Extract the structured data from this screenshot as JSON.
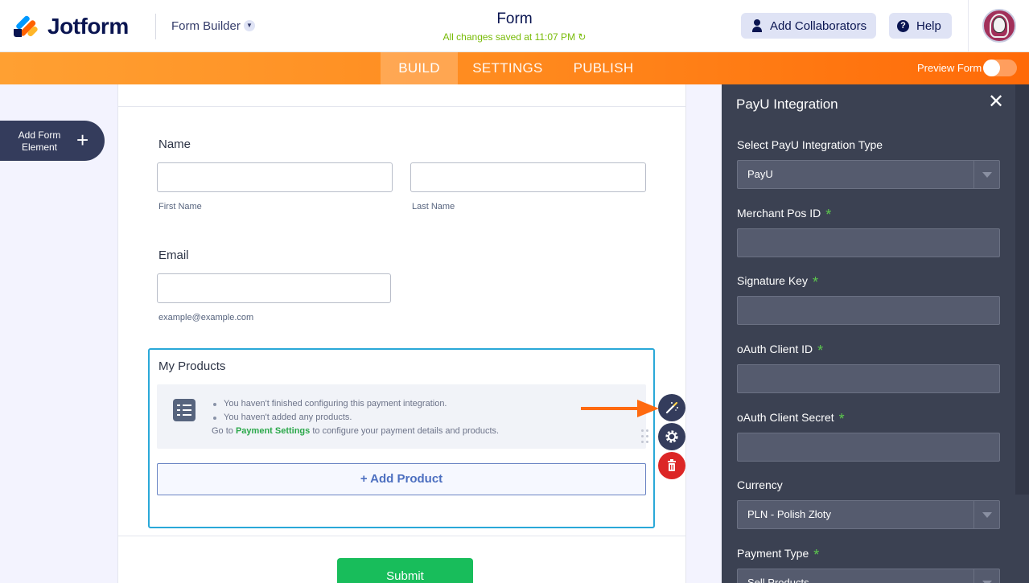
{
  "header": {
    "logo_text": "Jotform",
    "builder_label": "Form Builder",
    "form_title": "Form",
    "saved_status": "All changes saved at 11:07 PM",
    "add_collaborators_label": "Add Collaborators",
    "help_label": "Help"
  },
  "navbar": {
    "tabs": [
      {
        "label": "BUILD",
        "active": true
      },
      {
        "label": "SETTINGS",
        "active": false
      },
      {
        "label": "PUBLISH",
        "active": false
      }
    ],
    "preview_label": "Preview Form",
    "preview_enabled": false
  },
  "sidebar": {
    "add_element_label_line1": "Add Form",
    "add_element_label_line2": "Element"
  },
  "form": {
    "name_label": "Name",
    "first_name_sublabel": "First Name",
    "last_name_sublabel": "Last Name",
    "first_name_value": "",
    "last_name_value": "",
    "email_label": "Email",
    "email_value": "",
    "email_sublabel": "example@example.com",
    "products_title": "My Products",
    "notice_items": [
      "You haven't finished configuring this payment integration.",
      "You haven't added any products."
    ],
    "notice_go_prefix": "Go to ",
    "notice_go_link": "Payment Settings",
    "notice_go_suffix": " to configure your payment details and products.",
    "add_product_label": "+ Add Product",
    "submit_label": "Submit"
  },
  "panel": {
    "title": "PayU Integration",
    "integration_type_label": "Select PayU Integration Type",
    "integration_type_value": "PayU",
    "merchant_pos_label": "Merchant Pos ID",
    "signature_key_label": "Signature Key",
    "oauth_client_id_label": "oAuth Client ID",
    "oauth_client_secret_label": "oAuth Client Secret",
    "currency_label": "Currency",
    "currency_value": "PLN - Polish Złoty",
    "payment_type_label": "Payment Type",
    "payment_type_value": "Sell Products",
    "required_mark": "*"
  },
  "colors": {
    "accent_orange": "#ff6100",
    "panel_bg": "#3b4152",
    "submit_green": "#18bd5b",
    "selected_border": "#2aa8d8",
    "delete_red": "#dc2626"
  },
  "icons": [
    "logo-icon",
    "chevron-down-icon",
    "user-icon",
    "help-icon",
    "avatar",
    "plus-icon",
    "checklist-icon",
    "wand-icon",
    "gear-icon",
    "trash-icon",
    "close-icon",
    "refresh-icon",
    "drag-handle-icon",
    "arrow-annotation"
  ]
}
